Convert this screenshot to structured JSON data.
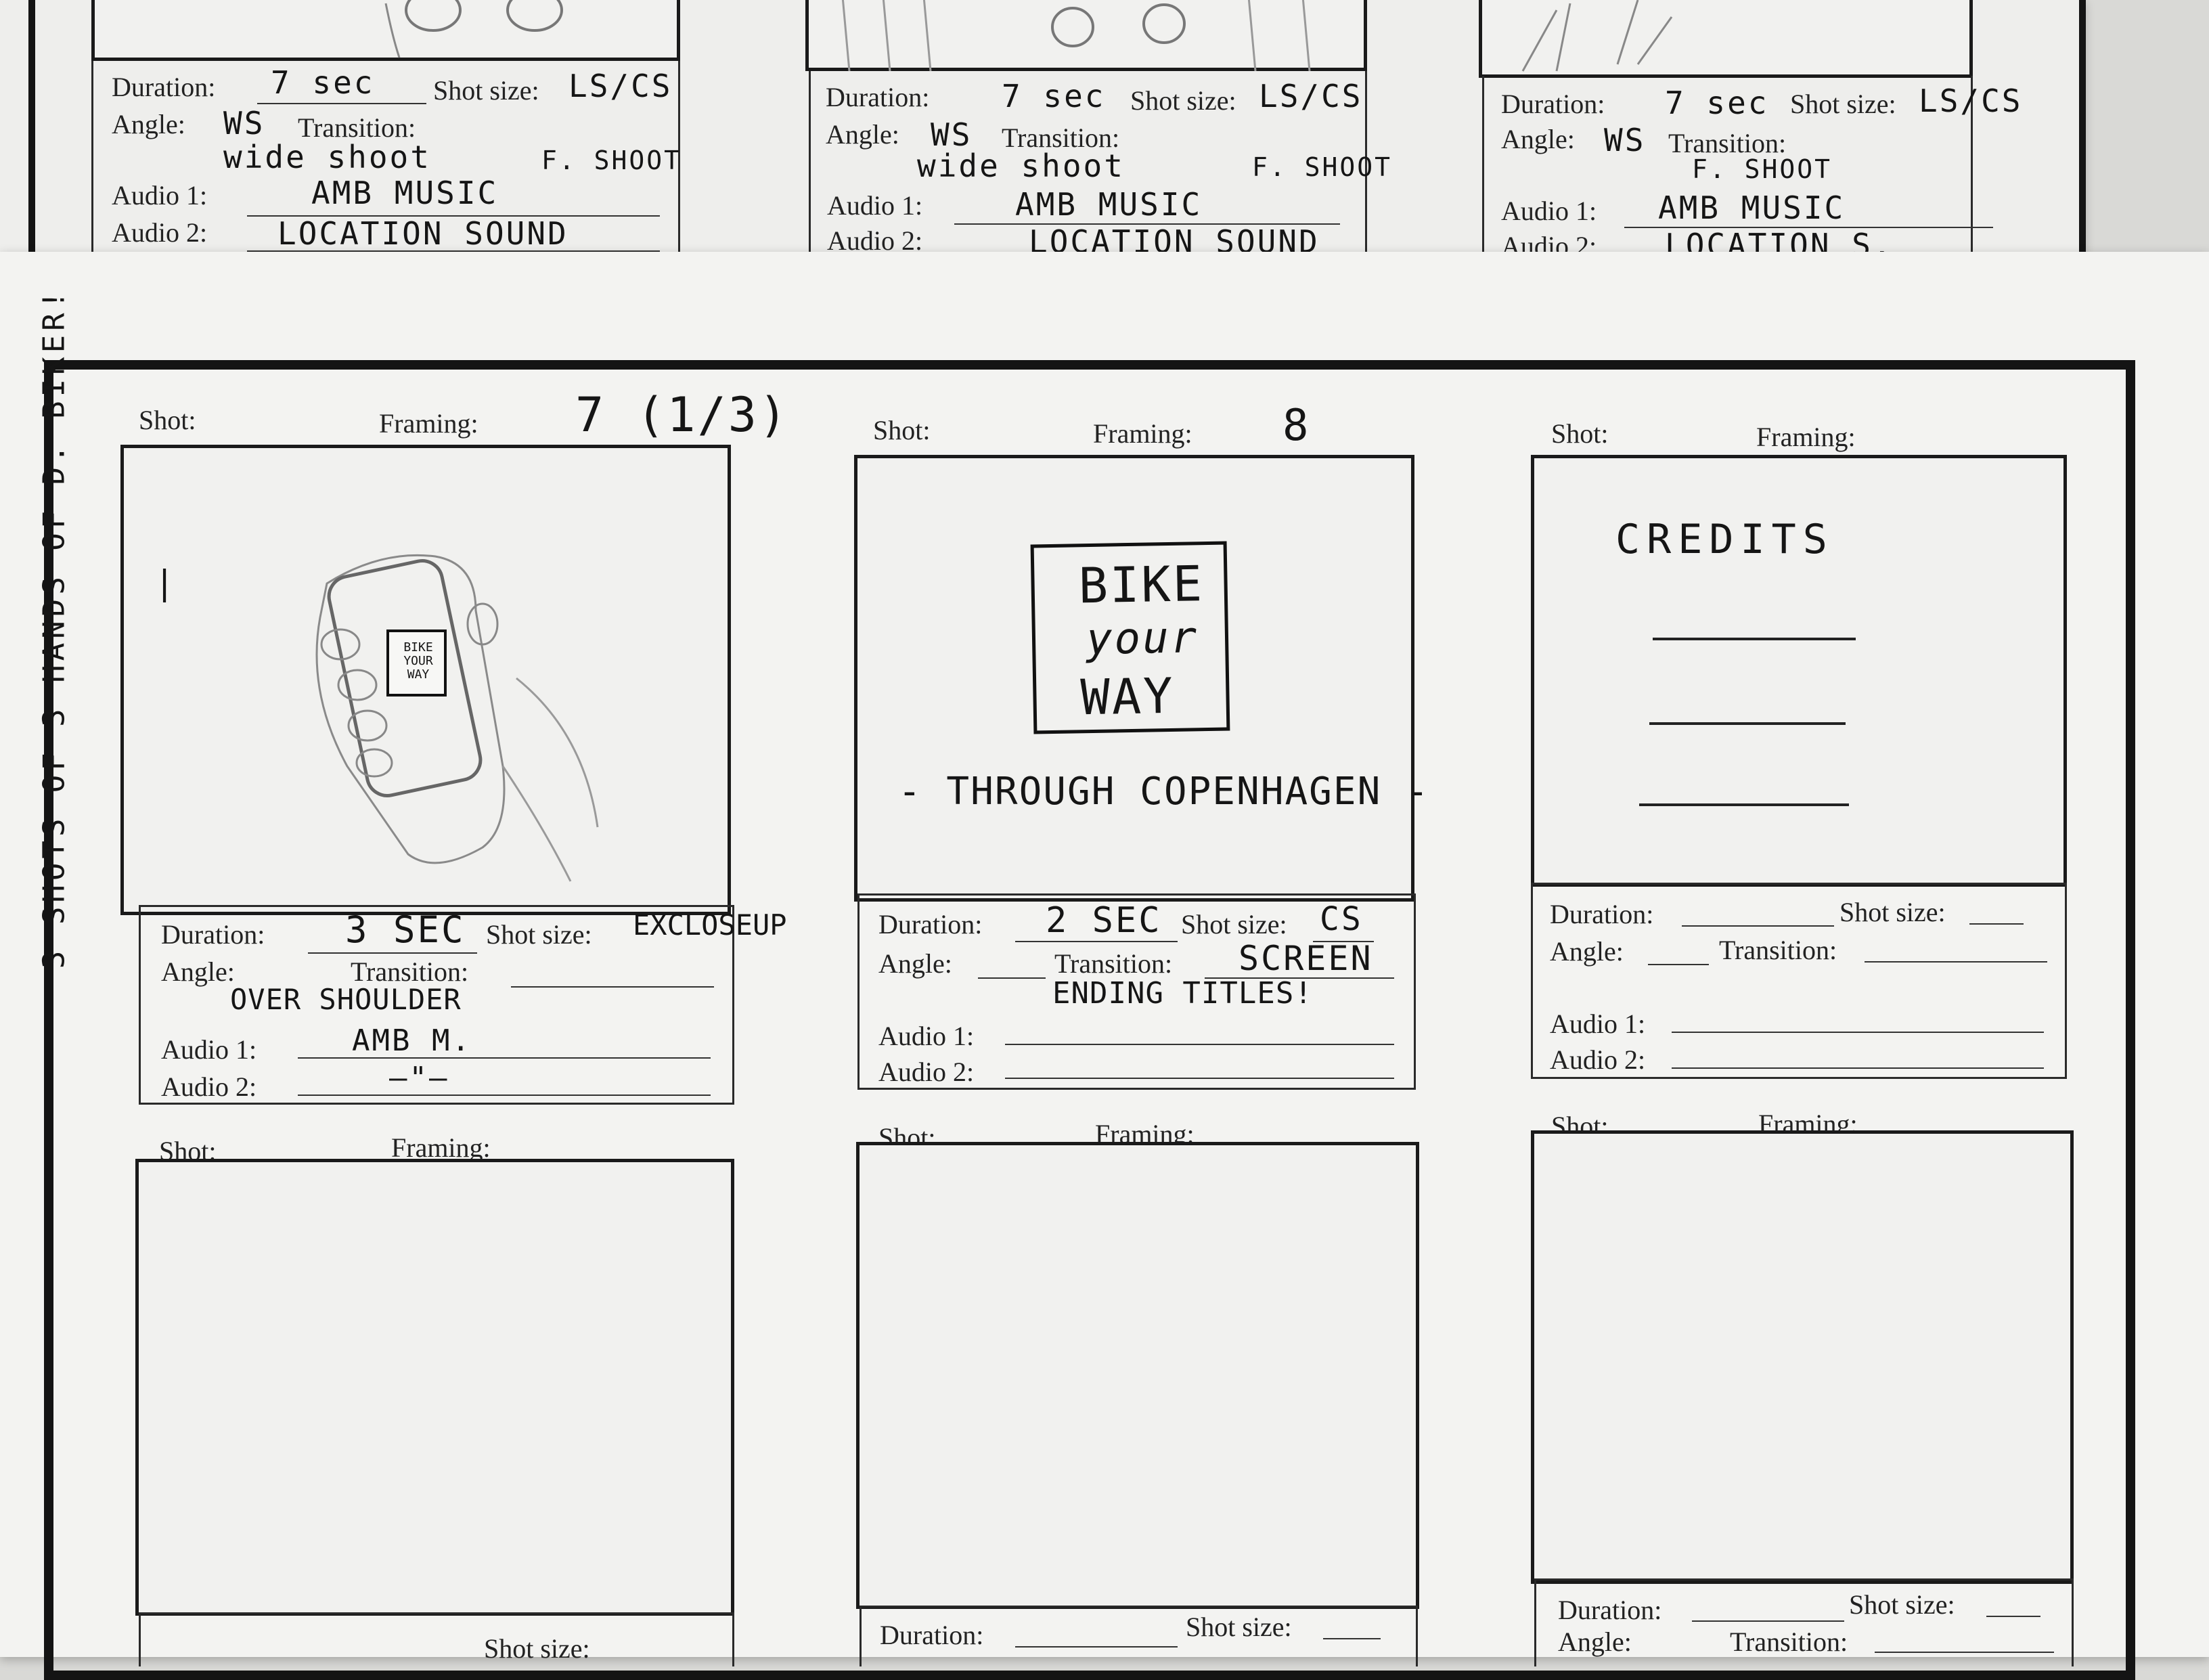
{
  "labels": {
    "shot": "Shot:",
    "framing": "Framing:",
    "duration": "Duration:",
    "shot_size": "Shot size:",
    "angle": "Angle:",
    "transition": "Transition:",
    "audio1": "Audio 1:",
    "audio2": "Audio 2:"
  },
  "side_note": "3 SHOTS OF 3 HANDS OF D. BIKER!",
  "top_row": [
    {
      "duration": "7 sec",
      "shot_size": "LS/CS",
      "angle": "WS",
      "transition": "F. SHOOT",
      "angle_note": "wide shoot",
      "audio1": "AMB MUSIC",
      "audio2": "LOCATION SOUND"
    },
    {
      "duration": "7 sec",
      "shot_size": "LS/CS",
      "angle": "WS",
      "transition": "F. SHOOT",
      "angle_note": "wide shoot",
      "audio1": "AMB MUSIC",
      "audio2": "LOCATION SOUND"
    },
    {
      "duration": "7 sec",
      "shot_size": "LS/CS",
      "angle": "WS",
      "transition": "F. SHOOT",
      "angle_note": "",
      "audio1": "AMB MUSIC",
      "audio2": "LOCATION S."
    }
  ],
  "panels": [
    {
      "framing_note": "7 (1/3)",
      "duration": "3 SEC",
      "shot_size": "EXCLOSEUP",
      "angle_note": "OVER SHOULDER",
      "audio1": "AMB M.",
      "audio2": "—\"—",
      "phone_text": "BIKE YOUR WAY"
    },
    {
      "framing_note": "8",
      "duration": "2 SEC",
      "shot_size": "CS",
      "transition": "SCREEN",
      "transition_note": "ENDING TITLES!",
      "sign_line1": "BIKE",
      "sign_line2": "your",
      "sign_line3": "WAY",
      "subtitle": "- THROUGH COPENHAGEN -"
    },
    {
      "credits": "CREDITS"
    }
  ]
}
